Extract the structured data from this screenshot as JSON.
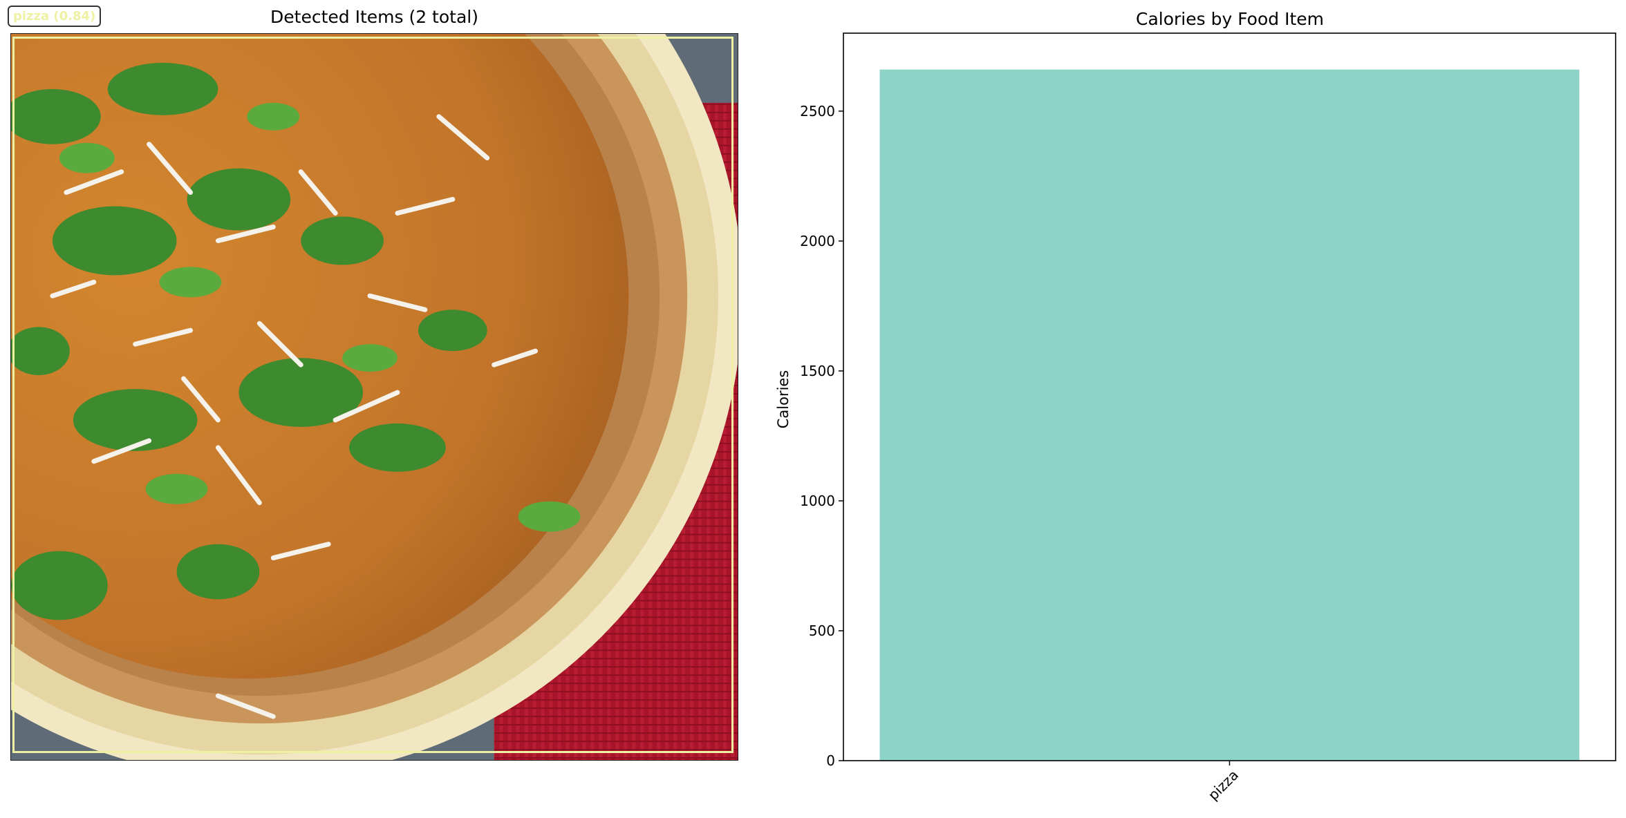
{
  "left_panel": {
    "title": "Detected Items (2 total)",
    "detection_label": "pizza (0.84)",
    "box_color": "#eef0a4"
  },
  "chart_data": {
    "type": "bar",
    "title": "Calories by Food Item",
    "categories": [
      "pizza"
    ],
    "values": [
      2660
    ],
    "xlabel": "",
    "ylabel": "Calories",
    "ylim": [
      0,
      2800
    ],
    "yticks": [
      0,
      500,
      1000,
      1500,
      2000,
      2500
    ],
    "bar_color": "#8dd3c7",
    "grid": false
  }
}
